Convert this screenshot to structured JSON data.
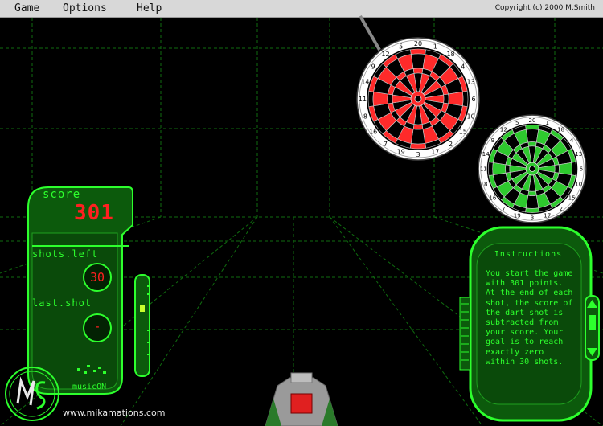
{
  "menu": {
    "items": [
      "Game",
      "Options",
      "Help"
    ],
    "copyright": "Copyright (c) 2000   M.Smith"
  },
  "score": {
    "label": "score",
    "value": "301"
  },
  "shots_left": {
    "label": "shots.left",
    "value": "30"
  },
  "last_shot": {
    "label": "last.shot",
    "value": "-"
  },
  "music": {
    "label": "music",
    "state": "ON"
  },
  "site_link": "www.mikamations.com",
  "instructions": {
    "title": "Instructions",
    "text": "You start the game with 301 points. At the end of each shot, the score of the dart shot is subtracted from your score. Your goal is to reach exactly zero within 30 shots."
  },
  "dartboard_numbers": [
    "20",
    "1",
    "18",
    "4",
    "13",
    "6",
    "10",
    "15",
    "2",
    "17",
    "3",
    "19",
    "7",
    "16",
    "8",
    "11",
    "14",
    "9",
    "12",
    "5"
  ],
  "colors": {
    "neon_green": "#2dff2d",
    "grid_green": "#0f6b0f",
    "score_red": "#ff2020",
    "dartboard_red": "#ff2a2a",
    "dartboard_green": "#2ec92e"
  },
  "icons": {
    "logo": "ms-logo",
    "dartboard_primary": "dartboard-red",
    "dartboard_secondary": "dartboard-green",
    "dart_launcher": "dart-launcher-icon"
  }
}
